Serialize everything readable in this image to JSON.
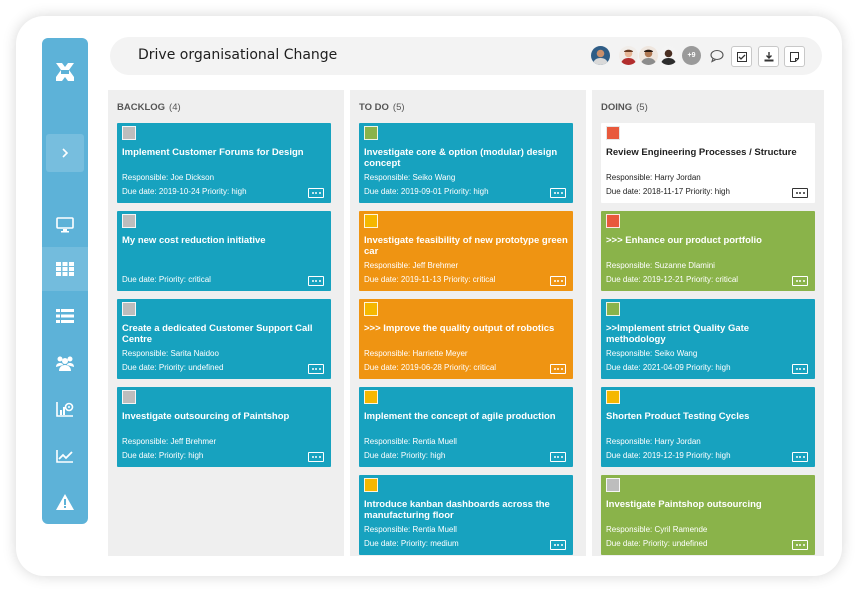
{
  "header": {
    "title": "Drive organisational Change",
    "more_avatars": "+9"
  },
  "sidebar": {
    "items": [
      {
        "icon": "monitor-icon"
      },
      {
        "icon": "grid-icon",
        "active": true
      },
      {
        "icon": "list-icon"
      },
      {
        "icon": "users-icon"
      },
      {
        "icon": "settings-chart-icon"
      },
      {
        "icon": "line-chart-icon"
      },
      {
        "icon": "warning-icon"
      }
    ]
  },
  "columns": [
    {
      "name": "BACKLOG",
      "count": "(4)",
      "cards": [
        {
          "title": "Implement Customer Forums for Design",
          "responsible": "Responsible: Joe Dickson",
          "due": "Due date: 2019-10-24  Priority: high"
        },
        {
          "title": "My new cost reduction initiative",
          "responsible": "",
          "due": "Due date:  Priority: critical"
        },
        {
          "title": "Create a dedicated Customer Support Call Centre",
          "responsible": "Responsible: Sarita Naidoo",
          "due": "Due date:  Priority: undefined"
        },
        {
          "title": "Investigate outsourcing of Paintshop",
          "responsible": "Responsible: Jeff Brehmer",
          "due": "Due date:  Priority: high"
        }
      ]
    },
    {
      "name": "TO DO",
      "count": "(5)",
      "cards": [
        {
          "title": "Investigate core & option (modular) design concept",
          "responsible": "Responsible: Seiko Wang",
          "due": "Due date: 2019-09-01  Priority: high"
        },
        {
          "title": "Investigate feasibility of new prototype green car",
          "responsible": "Responsible: Jeff Brehmer",
          "due": "Due date: 2019-11-13  Priority: critical"
        },
        {
          "title": ">>> Improve the quality output of robotics",
          "responsible": "Responsible: Harriette Meyer",
          "due": "Due date: 2019-06-28  Priority: critical"
        },
        {
          "title": "Implement the concept of agile production",
          "responsible": "Responsible: Rentia Muell",
          "due": "Due date:  Priority: high"
        },
        {
          "title": "Introduce kanban dashboards across the manufacturing floor",
          "responsible": "Responsible: Rentia Muell",
          "due": "Due date:  Priority: medium"
        }
      ]
    },
    {
      "name": "DOING",
      "count": "(5)",
      "cards": [
        {
          "title": "Review Engineering Processes / Structure",
          "responsible": "Responsible: Harry Jordan",
          "due": "Due date: 2018-11-17  Priority: high"
        },
        {
          "title": ">>> Enhance our product portfolio",
          "responsible": "Responsible: Suzanne Dlamini",
          "due": "Due date: 2019-12-21  Priority: critical"
        },
        {
          "title": ">>Implement strict Quality Gate methodology",
          "responsible": "Responsible: Seiko Wang",
          "due": "Due date: 2021-04-09  Priority: high"
        },
        {
          "title": "Shorten Product Testing Cycles",
          "responsible": "Responsible: Harry Jordan",
          "due": "Due date: 2019-12-19  Priority: high"
        },
        {
          "title": "Investigate Paintshop outsourcing",
          "responsible": "Responsible: Cyril Ramende",
          "due": "Due date:  Priority: undefined"
        }
      ]
    }
  ],
  "colors": {
    "sidebar": "#5db2d8",
    "card_blue": "#17a2bf",
    "card_orange": "#ef9412",
    "card_green": "#8ab34a",
    "swatch_yellow": "#f5b700",
    "swatch_red": "#e8593c",
    "swatch_grey": "#bdbdbd"
  }
}
